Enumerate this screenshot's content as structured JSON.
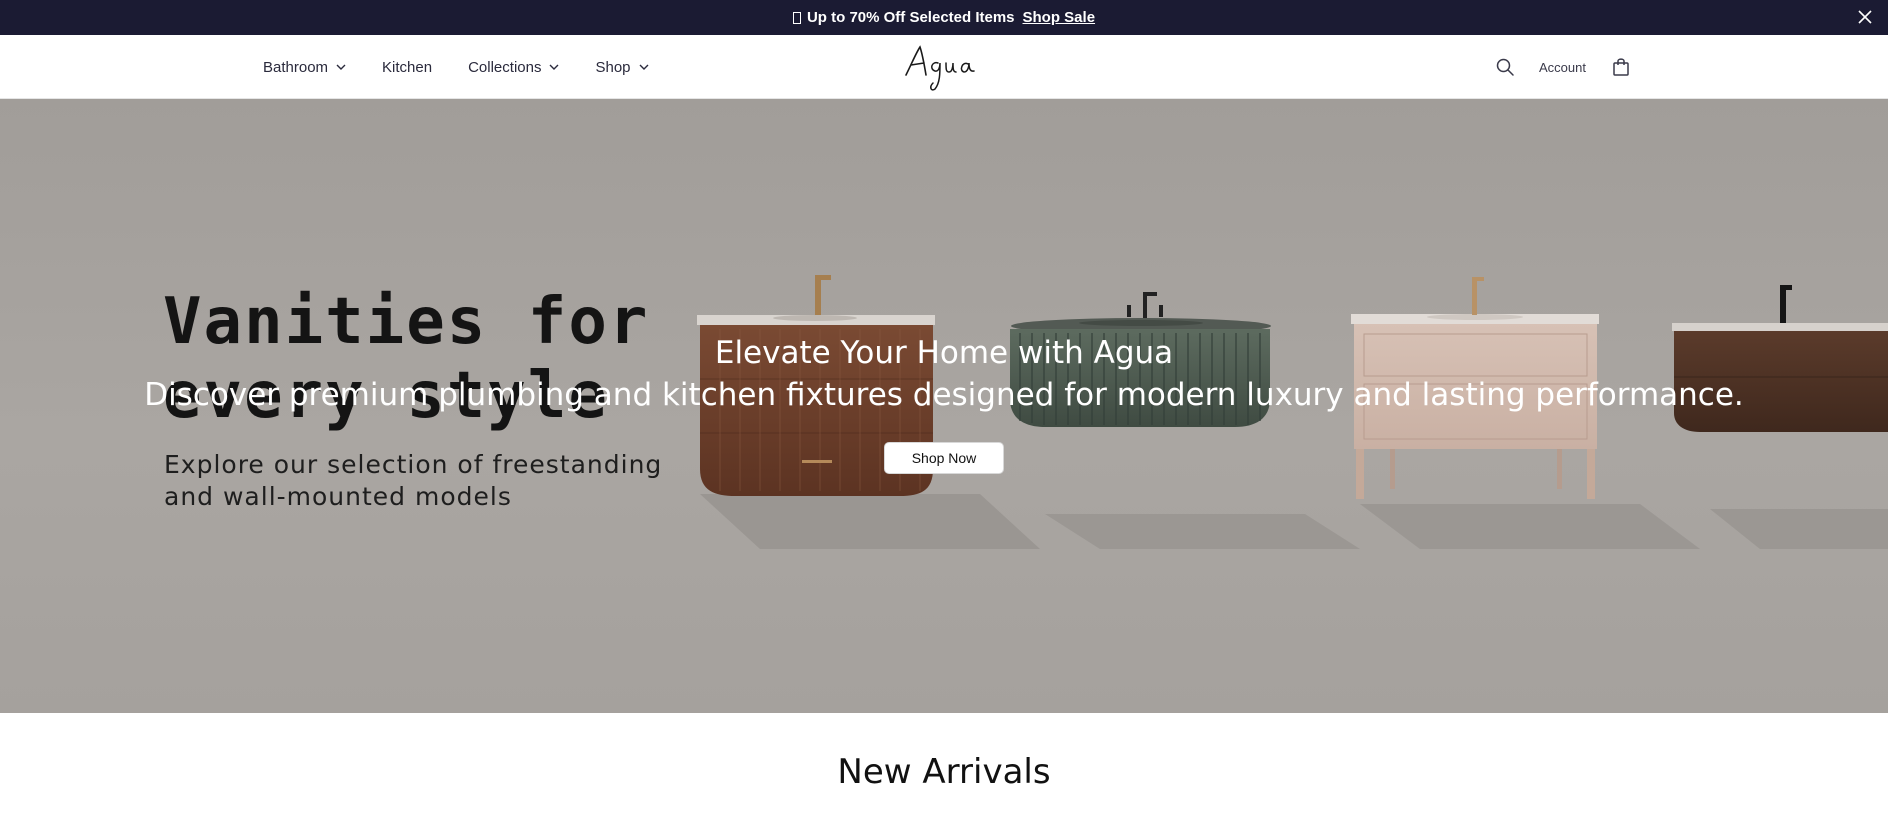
{
  "announcement": {
    "icon": "gift-icon",
    "text": "Up to 70% Off Selected Items",
    "link": "Shop Sale"
  },
  "nav": {
    "items": [
      {
        "label": "Bathroom",
        "has_dropdown": true
      },
      {
        "label": "Kitchen",
        "has_dropdown": false
      },
      {
        "label": "Collections",
        "has_dropdown": true
      },
      {
        "label": "Shop",
        "has_dropdown": true
      }
    ],
    "logo_text": "Agua",
    "account_label": "Account"
  },
  "hero": {
    "title": "Vanities for every style",
    "subtitle": "Explore our selection of freestanding and wall-mounted models",
    "overlay_heading": "Elevate Your Home with Agua",
    "overlay_text": "Discover premium plumbing and kitchen fixtures designed for modern luxury and lasting performance.",
    "cta_label": "Shop Now"
  },
  "section": {
    "title": "New Arrivals"
  },
  "colors": {
    "announcement_bg": "#1b1b33",
    "hero_bg": "#a5a19d",
    "text_dark": "#141414"
  }
}
